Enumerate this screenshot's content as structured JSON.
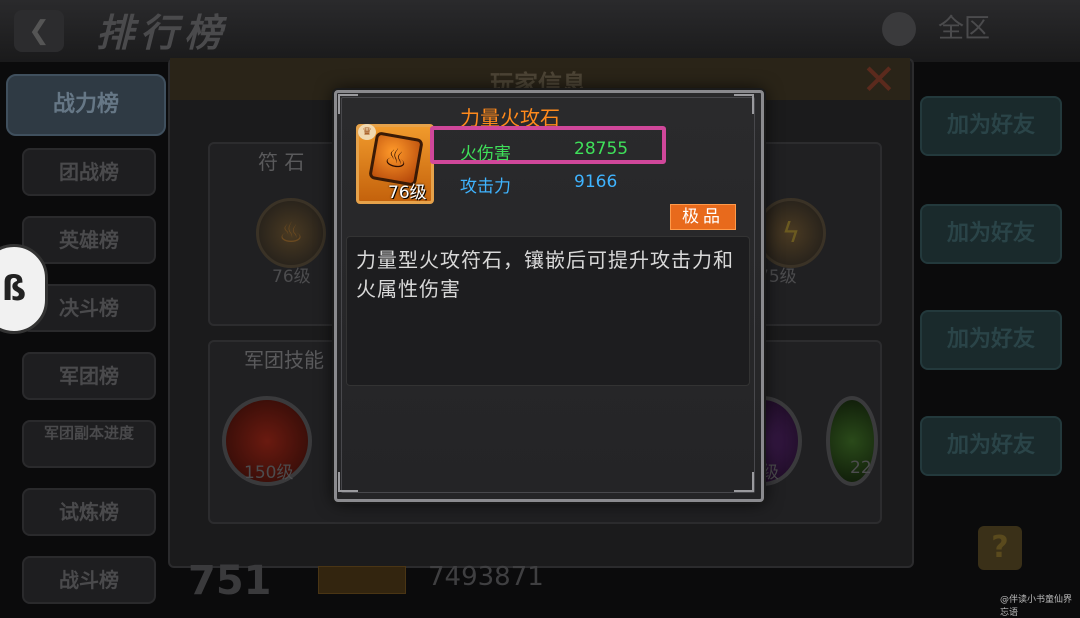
{
  "background": {
    "title": "排行榜",
    "server": "全区",
    "menu": {
      "active": "战力榜",
      "items": [
        "团战榜",
        "英雄榜",
        "决斗榜",
        "军团榜",
        "军团副本进度",
        "试炼榜",
        "战斗榜"
      ]
    },
    "dialog_title": "玩家信息",
    "rune_section": "符 石",
    "rune_levels": [
      "76级",
      "75级"
    ],
    "legion_section": "军团技能",
    "skill_levels": [
      "150级",
      "级",
      "22"
    ],
    "friend_buttons": [
      "加为好友",
      "加为好友",
      "加为好友",
      "加为好友"
    ],
    "bottom": {
      "rank": "751",
      "power": "7493871"
    }
  },
  "popup": {
    "item_name": "力量火攻石",
    "item_level": "76级",
    "stats": [
      {
        "name": "火伤害",
        "value": "28755",
        "color": "#3fe05a"
      },
      {
        "name": "攻击力",
        "value": "9166",
        "color": "#3fb4ff"
      }
    ],
    "quality": "极品",
    "description": "力量型火攻符石，镶嵌后可提升攻击力和火属性伤害"
  },
  "colors": {
    "item_name": "#ff8a1c",
    "highlight_border": "#d0479a",
    "quality_bg": "#e86a1c"
  },
  "icons": {
    "item": "fire-rune-icon",
    "crown": "crown-icon",
    "close": "close-icon",
    "back": "back-icon"
  },
  "watermark": "@伴读小书童仙界忘语"
}
